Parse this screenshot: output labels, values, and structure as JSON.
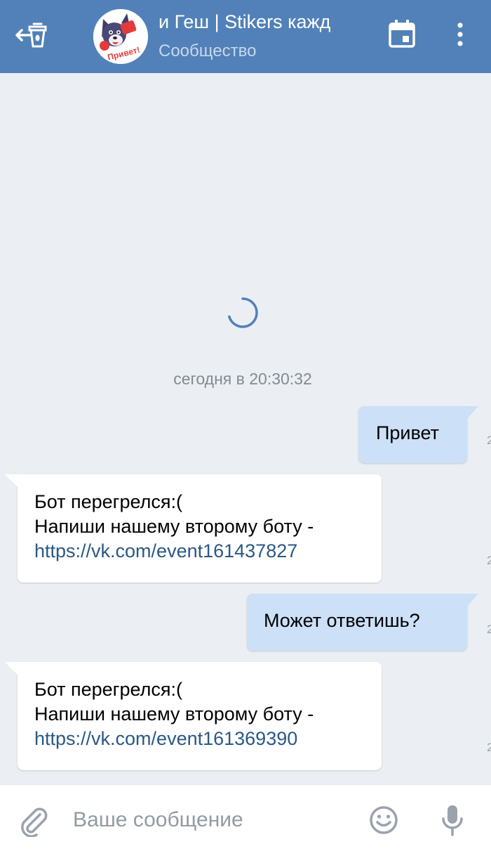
{
  "header": {
    "title": "и Геш | Stikers кажд",
    "subtitle": "Сообщество",
    "avatar_text": "Привет!"
  },
  "chat": {
    "date_separator": "сегодня в 20:30:32",
    "edge_time": "2",
    "messages": [
      {
        "direction": "out",
        "text": "Привет"
      },
      {
        "direction": "in",
        "line1": "Бот перегрелся:(",
        "line2": "Напиши нашему второму боту -",
        "link": "https://vk.com/event161437827"
      },
      {
        "direction": "out",
        "text": "Может ответишь?"
      },
      {
        "direction": "in",
        "line1": "Бот перегрелся:(",
        "line2": "Напиши нашему второму боту -",
        "link": "https://vk.com/event161369390"
      }
    ]
  },
  "composer": {
    "placeholder": "Ваше сообщение"
  },
  "colors": {
    "header_bg": "#5181b8",
    "chat_bg": "#ebeff4",
    "outgoing_bubble": "#cce0f8",
    "incoming_bubble": "#ffffff",
    "link": "#2a5885"
  }
}
